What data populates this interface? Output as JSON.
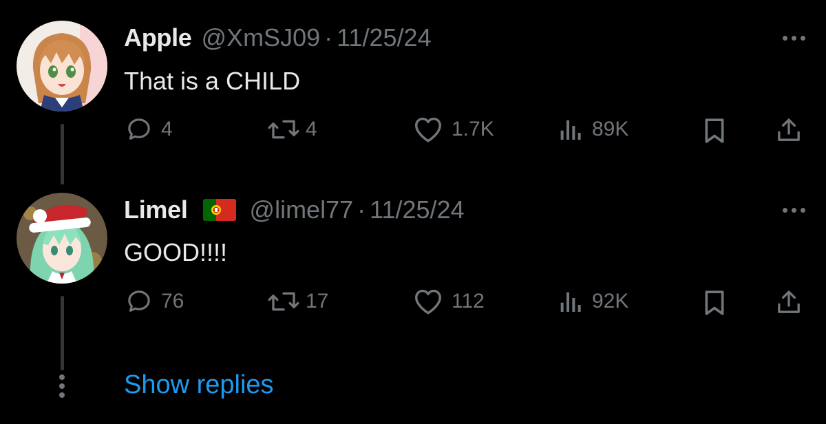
{
  "tweets": [
    {
      "name": "Apple",
      "handle": "@XmSJ09",
      "separator": "·",
      "date": "11/25/24",
      "text": "That is a CHILD",
      "replies": "4",
      "retweets": "4",
      "likes": "1.7K",
      "views": "89K",
      "flag": null
    },
    {
      "name": "Limel",
      "handle": "@limel77",
      "separator": "·",
      "date": "11/25/24",
      "text": "GOOD!!!!",
      "replies": "76",
      "retweets": "17",
      "likes": "112",
      "views": "92K",
      "flag": "portugal-flag-emoji"
    }
  ],
  "show_replies_label": "Show replies",
  "icons": {
    "reply": "reply-bubble-icon",
    "retweet": "retweet-icon",
    "like": "heart-icon",
    "views": "bar-chart-icon",
    "bookmark": "bookmark-icon",
    "share": "share-icon",
    "more": "more-dots-icon"
  },
  "colors": {
    "background": "#000000",
    "primary_text": "#e7e9ea",
    "secondary_text": "#71767b",
    "link": "#1d9bf0",
    "thread_line": "#333639"
  }
}
